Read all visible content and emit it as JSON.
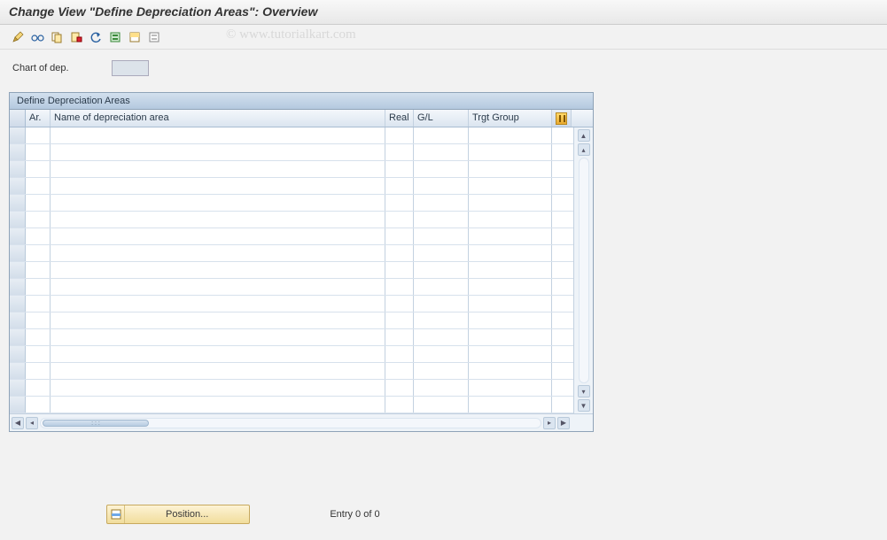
{
  "header": {
    "title": "Change View \"Define Depreciation Areas\": Overview"
  },
  "watermark": "© www.tutorialkart.com",
  "toolbar": {
    "icons": [
      "display-change-icon",
      "glasses-icon",
      "copy-icon",
      "delete-icon",
      "undo-icon",
      "select-all-icon",
      "select-block-icon",
      "deselect-all-icon"
    ]
  },
  "field": {
    "label": "Chart of dep.",
    "value": ""
  },
  "table": {
    "title": "Define Depreciation Areas",
    "columns": {
      "ar": "Ar.",
      "name": "Name of depreciation area",
      "real": "Real",
      "gl": "G/L",
      "trgt": "Trgt Group"
    },
    "rows": [
      {},
      {},
      {},
      {},
      {},
      {},
      {},
      {},
      {},
      {},
      {},
      {},
      {},
      {},
      {},
      {},
      {}
    ]
  },
  "footer": {
    "position_label": "Position...",
    "entry_text": "Entry 0 of 0"
  }
}
